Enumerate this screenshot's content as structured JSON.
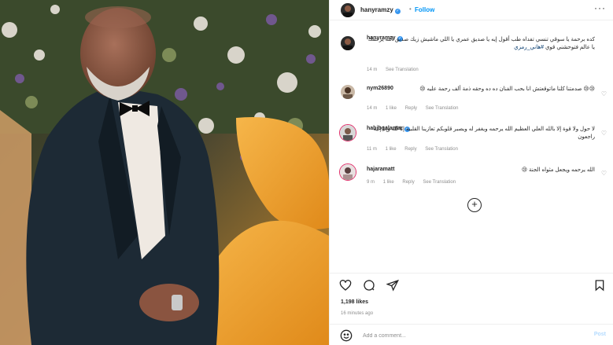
{
  "post": {
    "author": "hanyramzy",
    "follow_label": "Follow",
    "separator": "•",
    "more_label": "···"
  },
  "comments": [
    {
      "username": "hanyramzy",
      "text": "كده برحمة يا سوقي تنسي تفداه طب أقول إيه يا صديق عمري يا اللي ماشيش زيك صديق الله يرحمك يا عالم فتوحشني قوي",
      "link": "#هاني_رمزي",
      "time": "14 m",
      "likes": "",
      "reply": "",
      "see_translation": "See Translation"
    },
    {
      "username": "nym26890",
      "text": "😢😢 صدمتنا كلنا ماتوقعتش انا بحب الفنان ده ده وحقه ذمة ألف رحمة عليه 😢",
      "link": "",
      "time": "14 m",
      "likes": "1 like",
      "reply": "Reply",
      "see_translation": "See Translation"
    },
    {
      "username": "habibgalantar",
      "text": "لا حول ولا قوة إلا بالله العلي العظيم الله يرحمه ويغفر له ويصبر قلوبكم تعازينا القلبية إنا لله وإنا إليه راجعون",
      "link": "",
      "time": "11 m",
      "likes": "1 like",
      "reply": "Reply",
      "see_translation": "See Translation"
    },
    {
      "username": "hajaramatt",
      "text": "الله يرحمه ويجعل مثواه الجنة 😢",
      "link": "",
      "time": "9 m",
      "likes": "1 like",
      "reply": "Reply",
      "see_translation": "See Translation"
    }
  ],
  "footer": {
    "likes": "1,198 likes",
    "time": "16 minutes ago",
    "comment_placeholder": "Add a comment...",
    "post_label": "Post"
  },
  "icons": {
    "heart": "heart-icon",
    "comment": "comment-icon",
    "share": "share-icon",
    "save": "bookmark-icon",
    "emoji": "emoji-icon",
    "load_more": "plus-circle-icon"
  },
  "colors": {
    "accent": "#0095f6",
    "verified": "#3897f0",
    "muted": "#8e8e8e"
  }
}
